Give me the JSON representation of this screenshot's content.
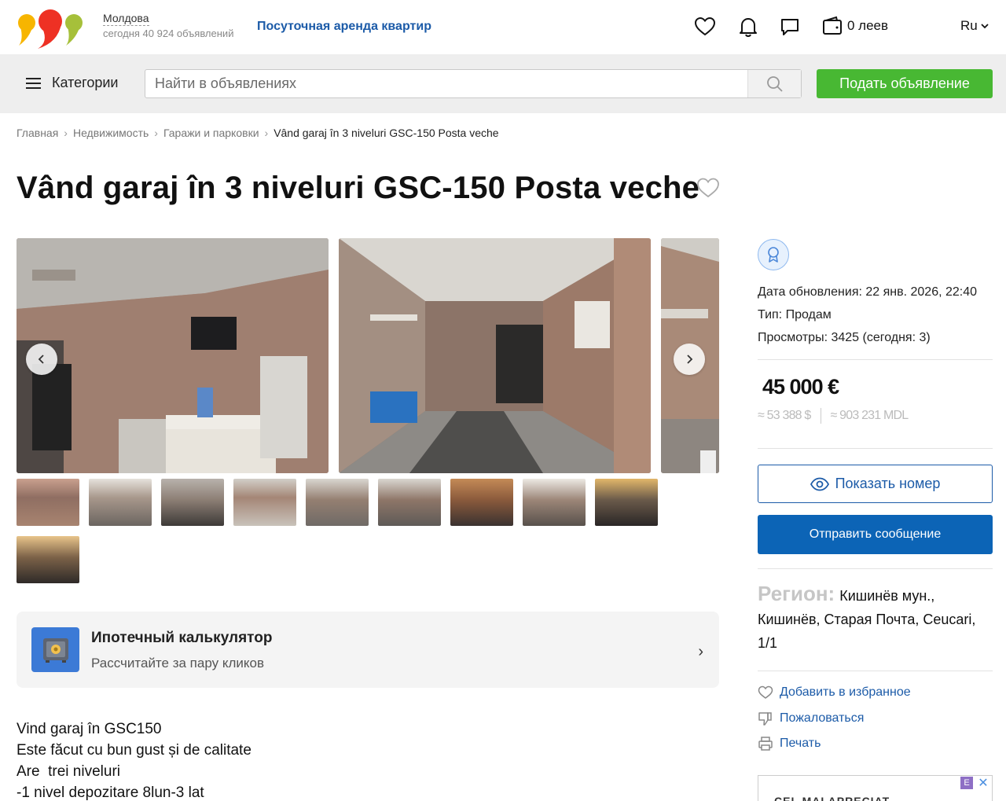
{
  "header": {
    "region_name": "Молдова",
    "region_count": "сегодня 40 924 объявлений",
    "promo_link": "Посуточная аренда квартир",
    "wallet": "0 леев",
    "language": "Ru"
  },
  "searchbar": {
    "categories_label": "Категории",
    "placeholder": "Найти в объявлениях",
    "post_button": "Подать объявление"
  },
  "breadcrumb": {
    "items": [
      "Главная",
      "Недвижимость",
      "Гаражи и парковки"
    ],
    "current": "Vând garaj în 3 niveluri GSC-150 Posta veche"
  },
  "listing": {
    "title": "Vând garaj în 3 niveluri GSC-150 Posta veche",
    "description": "Vind garaj în GSC150\nEste făcut cu bun gust și de calitate\nAre  trei niveluri\n-1 nivel depozitare 8lun-3 lat"
  },
  "mortgage": {
    "title": "Ипотечный калькулятор",
    "subtitle": "Рассчитайте за пару кликов"
  },
  "sidebar": {
    "updated": "Дата обновления: 22 янв. 2026, 22:40",
    "type": "Тип: Продам",
    "views": "Просмотры: 3425 (сегодня: 3)",
    "price": "45 000 €",
    "price_usd": "≈ 53 388 $",
    "price_mdl": "≈ 903 231 MDL",
    "show_phone": "Показать номер",
    "send_message": "Отправить сообщение",
    "region_label": "Регион:",
    "region_value": "Кишинёв мун., Кишинёв, Старая Почта, Ceucari, 1/1",
    "add_favorite": "Добавить в избранное",
    "complain": "Пожаловаться",
    "print": "Печать"
  },
  "ad": {
    "text": "CEL MAI APRECIAT",
    "badge": "E"
  },
  "colors": {
    "brand_blue": "#1c5ba8",
    "button_blue": "#0c64b6",
    "post_green": "#48b833"
  }
}
